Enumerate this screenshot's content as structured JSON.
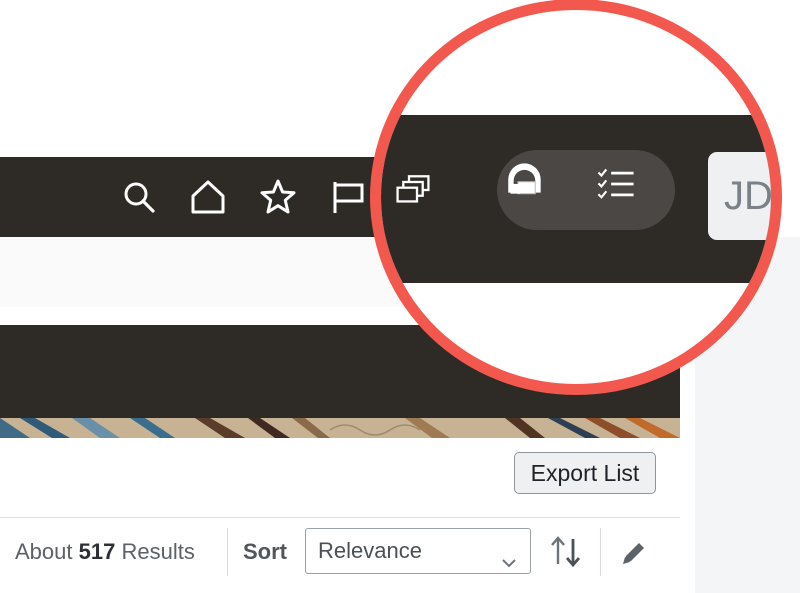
{
  "toolbar": {
    "icons": [
      "search-icon",
      "home-icon",
      "favorites-star-icon",
      "flag-icon"
    ]
  },
  "magnified": {
    "icons": [
      "windows-stack-icon",
      "assistant-dome-icon",
      "checklist-icon"
    ],
    "avatar_initials": "JD",
    "status_color": "#21a05a"
  },
  "actions": {
    "export_label": "Export List"
  },
  "results": {
    "prefix": "About",
    "count": "517",
    "suffix": "Results"
  },
  "sort": {
    "label": "Sort",
    "selected": "Relevance"
  },
  "colors": {
    "bar": "#2e2b27",
    "highlight_ring": "#f2584d"
  }
}
